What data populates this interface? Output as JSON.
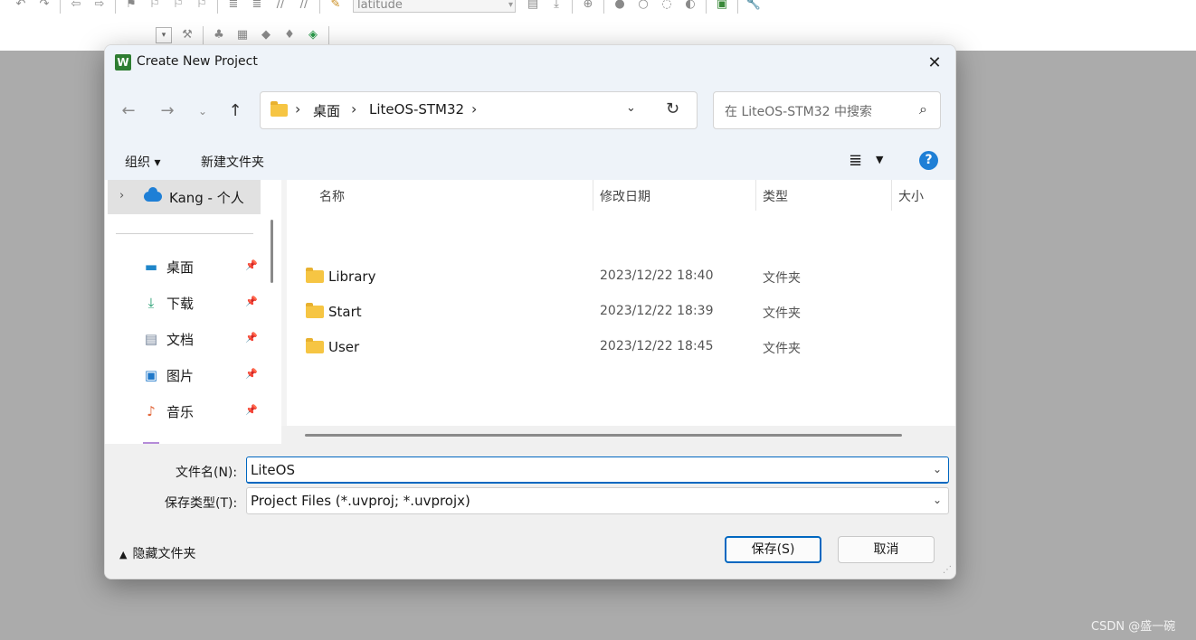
{
  "ide": {
    "config_combo_value": "latitude"
  },
  "dialog": {
    "title": "Create New Project",
    "app_icon_glyph": "W",
    "close_glyph": "✕",
    "breadcrumbs": [
      "桌面",
      "LiteOS-STM32"
    ],
    "search_placeholder": "在 LiteOS-STM32 中搜索",
    "organize_label": "组织 ▾",
    "new_folder_label": "新建文件夹",
    "nav_pane": {
      "onedrive_label": "Kang - 个人",
      "items": [
        {
          "label": "桌面",
          "icon": "desktop-icon"
        },
        {
          "label": "下载",
          "icon": "download-icon"
        },
        {
          "label": "文档",
          "icon": "document-icon"
        },
        {
          "label": "图片",
          "icon": "pictures-icon"
        },
        {
          "label": "音乐",
          "icon": "music-icon"
        }
      ]
    },
    "columns": [
      "名称",
      "修改日期",
      "类型",
      "大小"
    ],
    "files": [
      {
        "name": "Library",
        "modified": "2023/12/22 18:40",
        "type": "文件夹"
      },
      {
        "name": "Start",
        "modified": "2023/12/22 18:39",
        "type": "文件夹"
      },
      {
        "name": "User",
        "modified": "2023/12/22 18:45",
        "type": "文件夹"
      }
    ],
    "filename_label": "文件名(N):",
    "filename_value": "LiteOS",
    "filetype_label": "保存类型(T):",
    "filetype_value": "Project Files (*.uvproj; *.uvprojx)",
    "hide_folders_label": "隐藏文件夹",
    "save_label": "保存(S)",
    "cancel_label": "取消"
  },
  "watermark": "CSDN @盛一碗",
  "colors": {
    "accent": "#0067c0",
    "folder": "#f6c543",
    "dialog_chrome": "#eef3f9",
    "desktop_bg": "#ababab"
  }
}
